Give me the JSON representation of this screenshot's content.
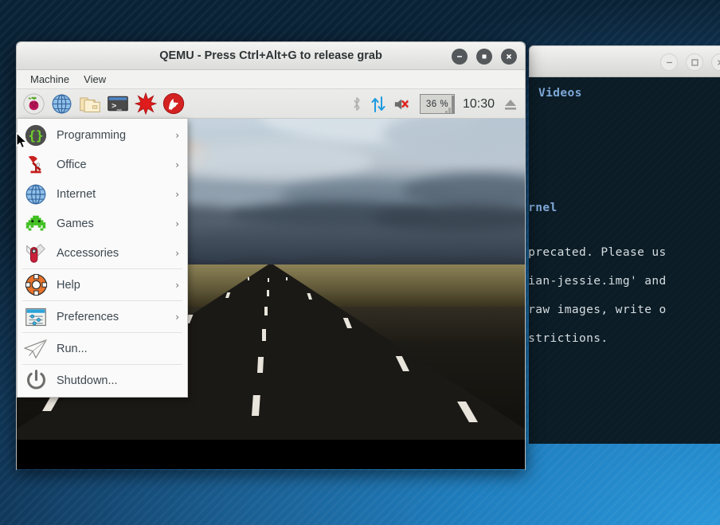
{
  "desktop": {
    "background_color_light": "#2a96d8",
    "background_color_dark": "#0a2236"
  },
  "terminal_window": {
    "title": "",
    "controls": [
      {
        "name": "minimize",
        "glyph": "–"
      },
      {
        "name": "maximize",
        "glyph": "□"
      },
      {
        "name": "close",
        "glyph": "✕"
      }
    ],
    "lines": [
      {
        "text": "Videos",
        "color": "#7ea8d8",
        "bold": true
      },
      {
        "text": "ernel",
        "color": "#7ea8d8",
        "bold": true
      },
      {
        "text": "eprecated. Please us",
        "color": "#d6dde1",
        "bold": false
      },
      {
        "text": "bian-jessie.img' and",
        "color": "#d6dde1",
        "bold": false
      },
      {
        "text": " raw images, write o",
        "color": "#d6dde1",
        "bold": false
      },
      {
        "text": "estrictions.",
        "color": "#d6dde1",
        "bold": false
      }
    ],
    "scrollbar": {
      "up_arrow": "▲",
      "down_arrow": "▼"
    }
  },
  "qemu_window": {
    "title": "QEMU - Press Ctrl+Alt+G to release grab",
    "controls": [
      {
        "name": "minimize",
        "glyph": "–"
      },
      {
        "name": "maximize",
        "glyph": "■"
      },
      {
        "name": "close",
        "glyph": "✕"
      }
    ],
    "menubar": [
      {
        "label": "Machine"
      },
      {
        "label": "View"
      }
    ]
  },
  "guest_taskbar": {
    "launchers": [
      {
        "name": "raspberry-menu-icon",
        "title": "Menu"
      },
      {
        "name": "web-browser-icon",
        "title": "Web Browser"
      },
      {
        "name": "file-manager-icon",
        "title": "File Manager"
      },
      {
        "name": "terminal-icon",
        "title": "Terminal"
      },
      {
        "name": "mathematica-icon",
        "title": "Mathematica"
      },
      {
        "name": "wolfram-icon",
        "title": "Wolfram"
      }
    ],
    "tray": {
      "bluetooth": {
        "name": "bluetooth-icon",
        "enabled": false
      },
      "network": {
        "name": "network-icon",
        "enabled": true
      },
      "volume": {
        "name": "volume-muted-icon",
        "muted": true
      },
      "cpu_meter": {
        "name": "cpu-meter",
        "value": "36 %"
      },
      "clock": {
        "name": "clock",
        "value": "10:30"
      },
      "eject": {
        "name": "eject-icon"
      }
    }
  },
  "start_menu": {
    "items": [
      {
        "label": "Programming",
        "icon": "programming-icon",
        "has_submenu": true,
        "arrow": "›"
      },
      {
        "label": "Office",
        "icon": "office-icon",
        "has_submenu": true,
        "arrow": "›"
      },
      {
        "label": "Internet",
        "icon": "internet-icon",
        "has_submenu": true,
        "arrow": "›"
      },
      {
        "label": "Games",
        "icon": "games-icon",
        "has_submenu": true,
        "arrow": "›"
      },
      {
        "label": "Accessories",
        "icon": "accessories-icon",
        "has_submenu": true,
        "arrow": "›"
      },
      {
        "label": "Help",
        "icon": "help-icon",
        "has_submenu": true,
        "arrow": "›"
      },
      {
        "label": "Preferences",
        "icon": "preferences-icon",
        "has_submenu": true,
        "arrow": "›"
      },
      {
        "label": "Run...",
        "icon": "run-icon",
        "has_submenu": false,
        "arrow": ""
      },
      {
        "label": "Shutdown...",
        "icon": "shutdown-icon",
        "has_submenu": false,
        "arrow": ""
      }
    ]
  },
  "wallpaper": {
    "name": "road-at-sunset-wallpaper",
    "description": "Straight road vanishing to horizon under dramatic cloudy sky"
  }
}
